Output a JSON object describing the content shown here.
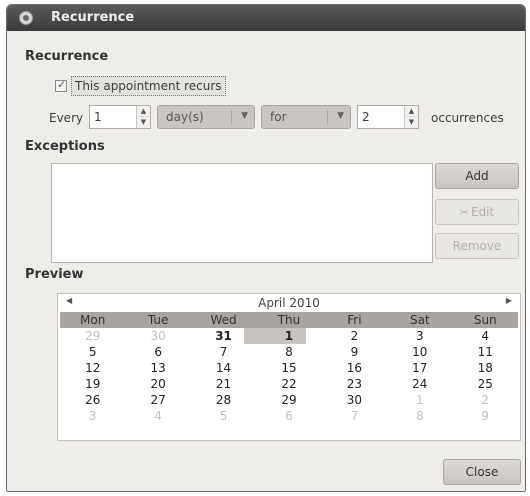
{
  "window": {
    "title": "Recurrence"
  },
  "recurrence": {
    "section_title": "Recurrence",
    "checkbox_label": "This appointment recurs",
    "checked": true,
    "every_label": "Every",
    "interval_value": "1",
    "unit_value": "day(s)",
    "range_value": "for",
    "count_value": "2",
    "count_suffix": "occurrences"
  },
  "exceptions": {
    "section_title": "Exceptions",
    "add_label": "Add",
    "edit_label": "Edit",
    "remove_label": "Remove"
  },
  "preview": {
    "section_title": "Preview",
    "month_label": "April 2010",
    "weekdays": [
      "Mon",
      "Tue",
      "Wed",
      "Thu",
      "Fri",
      "Sat",
      "Sun"
    ],
    "weeks": [
      [
        "29",
        "30",
        "31",
        "1",
        "2",
        "3",
        "4"
      ],
      [
        "5",
        "6",
        "7",
        "8",
        "9",
        "10",
        "11"
      ],
      [
        "12",
        "13",
        "14",
        "15",
        "16",
        "17",
        "18"
      ],
      [
        "19",
        "20",
        "21",
        "22",
        "23",
        "24",
        "25"
      ],
      [
        "26",
        "27",
        "28",
        "29",
        "30",
        "1",
        "2"
      ],
      [
        "3",
        "4",
        "5",
        "6",
        "7",
        "8",
        "9"
      ]
    ]
  },
  "footer": {
    "close_label": "Close"
  }
}
